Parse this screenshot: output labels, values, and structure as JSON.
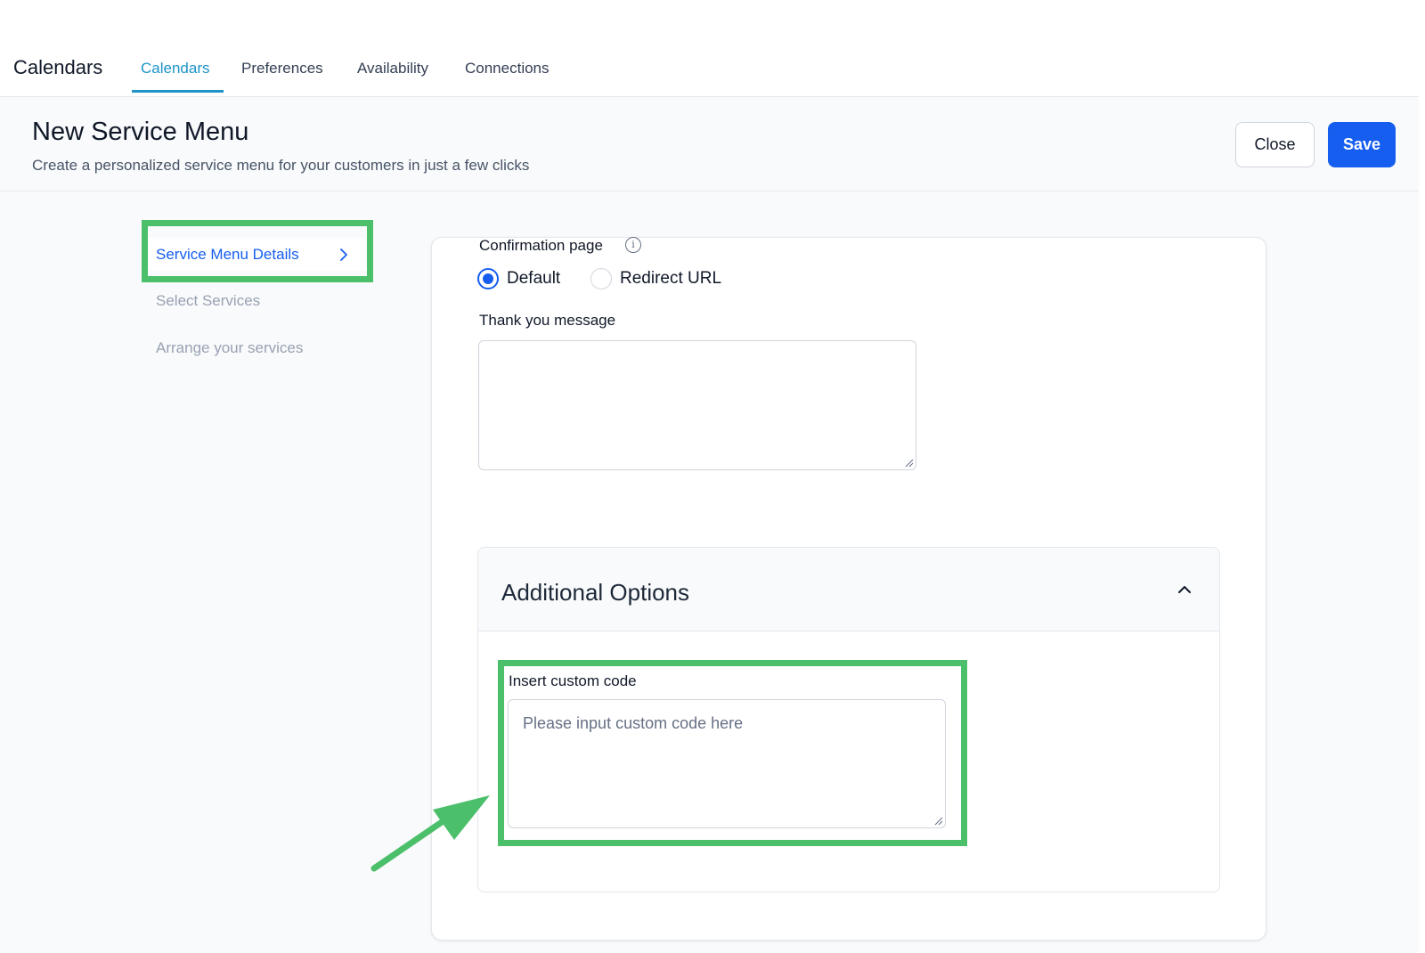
{
  "topnav": {
    "app_title": "Calendars",
    "tabs": [
      {
        "label": "Calendars",
        "active": true
      },
      {
        "label": "Preferences",
        "active": false
      },
      {
        "label": "Availability",
        "active": false
      },
      {
        "label": "Connections",
        "active": false
      }
    ]
  },
  "header": {
    "title": "New Service Menu",
    "subtitle": "Create a personalized service menu for your customers in just a few clicks",
    "close_label": "Close",
    "save_label": "Save"
  },
  "steps": [
    {
      "label": "Service Menu Details",
      "active": true
    },
    {
      "label": "Select Services",
      "active": false
    },
    {
      "label": "Arrange your services",
      "active": false
    }
  ],
  "form": {
    "confirmation_label": "Confirmation page",
    "radio_options": [
      {
        "label": "Default",
        "checked": true
      },
      {
        "label": "Redirect URL",
        "checked": false
      }
    ],
    "thank_you_label": "Thank you message",
    "thank_you_value": "",
    "additional_options": {
      "title": "Additional Options",
      "expanded": true,
      "custom_code_label": "Insert custom code",
      "custom_code_placeholder": "Please input custom code here",
      "custom_code_value": ""
    }
  },
  "colors": {
    "accent": "#155eef",
    "tab_active": "#1e93c9",
    "annotation_green": "#4cbf6b"
  },
  "icons": {
    "info": "info-icon",
    "step_chevron": "chevron-right-icon",
    "accordion_chevron": "chevron-up-icon",
    "annotation": "arrow-icon"
  }
}
